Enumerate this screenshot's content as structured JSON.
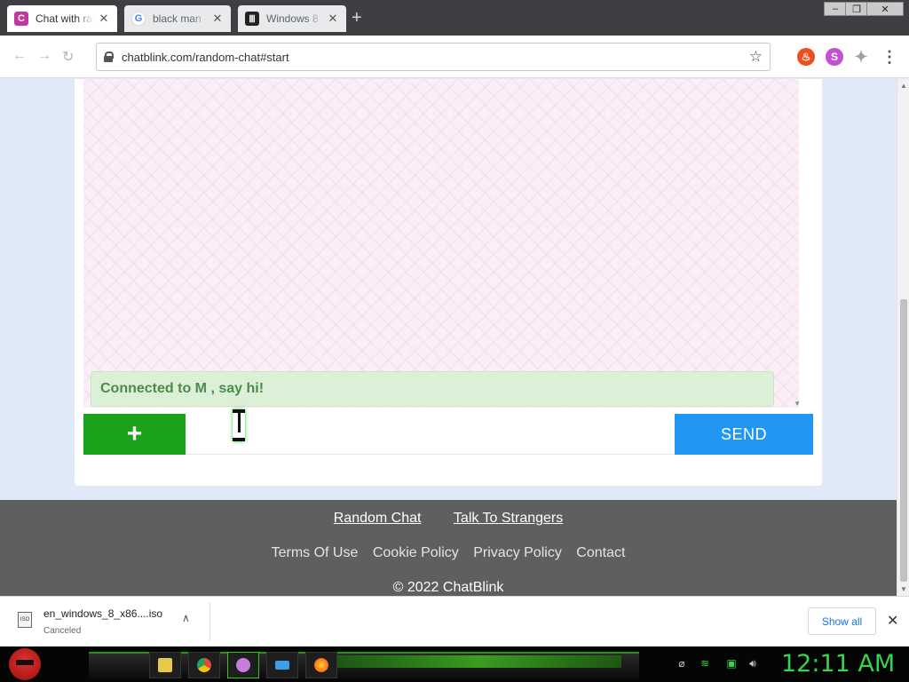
{
  "browser": {
    "tabs": [
      {
        "title": "Chat with random strangers",
        "favicon_letter": "C",
        "favicon_color": "#c03a9d",
        "active": true
      },
      {
        "title": "black man - Google Search",
        "favicon_letter": "G",
        "favicon_color": "#4285f4",
        "active": false
      },
      {
        "title": "Windows 8",
        "favicon_letter": "Ⅲ",
        "favicon_color": "#222222",
        "active": false
      }
    ],
    "new_tab": "+",
    "window_controls": {
      "minimize": "–",
      "restore": "❐",
      "close": "✕"
    },
    "address": "chatblink.com/random-chat#start",
    "nav": {
      "back": "←",
      "forward": "→",
      "reload": "↻"
    },
    "star": "☆",
    "extensions": [
      {
        "name": "fire-extension-icon",
        "glyph": "♨",
        "color": "#e8501e"
      },
      {
        "name": "s-extension-icon",
        "glyph": "S",
        "color": "#c34fd1"
      },
      {
        "name": "puzzle-extension-icon",
        "glyph": "✦",
        "color": "#9aa0a6"
      }
    ],
    "menu": "⋮"
  },
  "chat": {
    "system_message": "Connected to M , say hi!",
    "input_value": "",
    "plus_label": "+",
    "send_label": "SEND"
  },
  "footer": {
    "primary_links": [
      "Random Chat",
      "Talk To Strangers"
    ],
    "secondary_links": [
      "Terms Of Use",
      "Cookie Policy",
      "Privacy Policy",
      "Contact"
    ],
    "copyright": "© 2022 ChatBlink"
  },
  "downloads": {
    "file_name": "en_windows_8_x86....iso",
    "status": "Canceled",
    "icon_label": "ISO",
    "show_all": "Show all",
    "close": "✕",
    "chevron": "∧"
  },
  "taskbar": {
    "clock": "12:11 AM",
    "apps": [
      {
        "name": "file-explorer-icon",
        "color": "#e6c84a"
      },
      {
        "name": "chrome-icon",
        "color": "#dd4b39"
      },
      {
        "name": "app-purple-icon",
        "color": "#c77dd9"
      },
      {
        "name": "keyboard-icon",
        "color": "#3aa0e8"
      },
      {
        "name": "firefox-icon",
        "color": "#ff7b1a"
      }
    ]
  },
  "colors": {
    "send": "#2196f3",
    "plus": "#1aa31a",
    "system_message_bg": "#dcefd7",
    "footer_bg": "#5f5f5f"
  }
}
